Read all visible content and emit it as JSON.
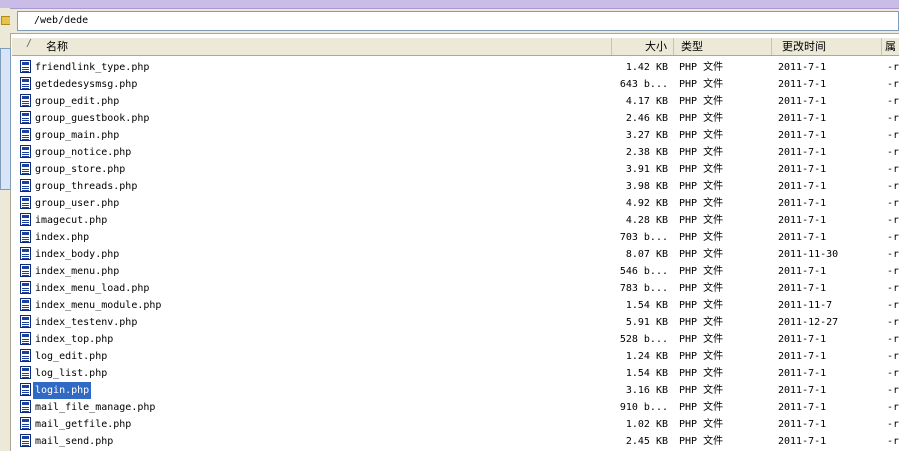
{
  "path": "/web/dede",
  "columns": {
    "name": "名称",
    "size": "大小",
    "type": "类型",
    "date": "更改时间",
    "attr": "属"
  },
  "files": [
    {
      "name": "friendlink_type.php",
      "size": "1.42 KB",
      "type": "PHP 文件",
      "date": "2011-7-1",
      "attr": "-r"
    },
    {
      "name": "getdedesysmsg.php",
      "size": "643 b...",
      "type": "PHP 文件",
      "date": "2011-7-1",
      "attr": "-r"
    },
    {
      "name": "group_edit.php",
      "size": "4.17 KB",
      "type": "PHP 文件",
      "date": "2011-7-1",
      "attr": "-r"
    },
    {
      "name": "group_guestbook.php",
      "size": "2.46 KB",
      "type": "PHP 文件",
      "date": "2011-7-1",
      "attr": "-r"
    },
    {
      "name": "group_main.php",
      "size": "3.27 KB",
      "type": "PHP 文件",
      "date": "2011-7-1",
      "attr": "-r"
    },
    {
      "name": "group_notice.php",
      "size": "2.38 KB",
      "type": "PHP 文件",
      "date": "2011-7-1",
      "attr": "-r"
    },
    {
      "name": "group_store.php",
      "size": "3.91 KB",
      "type": "PHP 文件",
      "date": "2011-7-1",
      "attr": "-r"
    },
    {
      "name": "group_threads.php",
      "size": "3.98 KB",
      "type": "PHP 文件",
      "date": "2011-7-1",
      "attr": "-r"
    },
    {
      "name": "group_user.php",
      "size": "4.92 KB",
      "type": "PHP 文件",
      "date": "2011-7-1",
      "attr": "-r"
    },
    {
      "name": "imagecut.php",
      "size": "4.28 KB",
      "type": "PHP 文件",
      "date": "2011-7-1",
      "attr": "-r"
    },
    {
      "name": "index.php",
      "size": "703 b...",
      "type": "PHP 文件",
      "date": "2011-7-1",
      "attr": "-r"
    },
    {
      "name": "index_body.php",
      "size": "8.07 KB",
      "type": "PHP 文件",
      "date": "2011-11-30",
      "attr": "-r"
    },
    {
      "name": "index_menu.php",
      "size": "546 b...",
      "type": "PHP 文件",
      "date": "2011-7-1",
      "attr": "-r"
    },
    {
      "name": "index_menu_load.php",
      "size": "783 b...",
      "type": "PHP 文件",
      "date": "2011-7-1",
      "attr": "-r"
    },
    {
      "name": "index_menu_module.php",
      "size": "1.54 KB",
      "type": "PHP 文件",
      "date": "2011-11-7",
      "attr": "-r"
    },
    {
      "name": "index_testenv.php",
      "size": "5.91 KB",
      "type": "PHP 文件",
      "date": "2011-12-27",
      "attr": "-r"
    },
    {
      "name": "index_top.php",
      "size": "528 b...",
      "type": "PHP 文件",
      "date": "2011-7-1",
      "attr": "-r"
    },
    {
      "name": "log_edit.php",
      "size": "1.24 KB",
      "type": "PHP 文件",
      "date": "2011-7-1",
      "attr": "-r"
    },
    {
      "name": "log_list.php",
      "size": "1.54 KB",
      "type": "PHP 文件",
      "date": "2011-7-1",
      "attr": "-r"
    },
    {
      "name": "login.php",
      "size": "3.16 KB",
      "type": "PHP 文件",
      "date": "2011-7-1",
      "attr": "-r",
      "selected": true
    },
    {
      "name": "mail_file_manage.php",
      "size": "910 b...",
      "type": "PHP 文件",
      "date": "2011-7-1",
      "attr": "-r"
    },
    {
      "name": "mail_getfile.php",
      "size": "1.02 KB",
      "type": "PHP 文件",
      "date": "2011-7-1",
      "attr": "-r"
    },
    {
      "name": "mail_send.php",
      "size": "2.45 KB",
      "type": "PHP 文件",
      "date": "2011-7-1",
      "attr": "-r"
    }
  ],
  "colors": {
    "selection": "#316ac5",
    "header_bg": "#ece9d8"
  },
  "icons": {
    "file": "php-file-icon"
  }
}
